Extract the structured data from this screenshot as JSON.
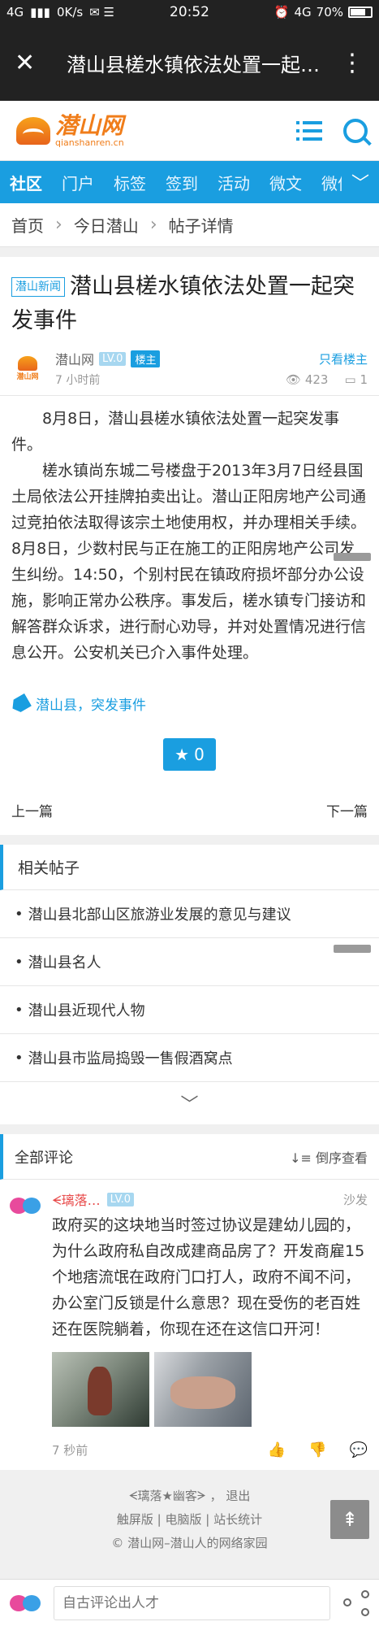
{
  "status_bar": {
    "network": "4G",
    "speed": "0K/s",
    "time": "20:52",
    "network_right": "4G",
    "battery": "70%"
  },
  "title_bar": {
    "title": "潜山县槎水镇依法处置一起…"
  },
  "logo": {
    "name": "潜山网",
    "domain": "qianshanren.cn"
  },
  "nav": {
    "items": [
      "社区",
      "门户",
      "标签",
      "签到",
      "活动",
      "微文",
      "微信"
    ]
  },
  "breadcrumb": [
    "首页",
    "今日潜山",
    "帖子详情"
  ],
  "post": {
    "category_tag": "潜山新闻",
    "title": "潜山县槎水镇依法处置一起突发事件",
    "author": "潜山网",
    "level": "LV.0",
    "host_badge": "楼主",
    "only_host": "只看楼主",
    "time": "7 小时前",
    "views": "423",
    "replies": "1",
    "paragraphs": [
      "8月8日，潜山县槎水镇依法处置一起突发事件。",
      "槎水镇尚东城二号楼盘于2013年3月7日经县国土局依法公开挂牌拍卖出让。潜山正阳房地产公司通过竞拍依法取得该宗土地使用权，并办理相关手续。8月8日，少数村民与正在施工的正阳房地产公司发生纠纷。14:50，个别村民在镇政府损坏部分办公设施，影响正常办公秩序。事发后，槎水镇专门接访和解答群众诉求，进行耐心劝导，并对处置情况进行信息公开。公安机关已介入事件处理。"
    ],
    "tags": "潜山县，突发事件",
    "favorites": "0",
    "prev": "上一篇",
    "next": "下一篇"
  },
  "related": {
    "heading": "相关帖子",
    "items": [
      "潜山县北部山区旅游业发展的意见与建议",
      "潜山县名人",
      "潜山县近现代人物",
      "潜山县市监局捣毁一售假酒窝点"
    ]
  },
  "comments": {
    "heading": "全部评论",
    "sort": "倒序查看",
    "items": [
      {
        "name": "ᗕ璃落…",
        "level": "LV.0",
        "floor": "沙发",
        "text": "政府买的这块地当时签过协议是建幼儿园的，为什么政府私自改成建商品房了？开发商雇15个地痞流氓在政府门口打人，政府不闻不问，办公室门反锁是什么意思？现在受伤的老百姓还在医院躺着，你现在还在这信口开河！",
        "time": "7 秒前"
      }
    ]
  },
  "footer": {
    "user": "ᗕ璃落★幽客ᗒ",
    "logout": "退出",
    "links": [
      "触屏版",
      "电脑版",
      "站长统计"
    ],
    "copyright": "© 潜山网–潜山人的网络家园"
  },
  "bottom_bar": {
    "placeholder": "自古评论出人才"
  },
  "colors": {
    "brand_blue": "#1a9ee0",
    "brand_orange": "#f07d1a"
  }
}
